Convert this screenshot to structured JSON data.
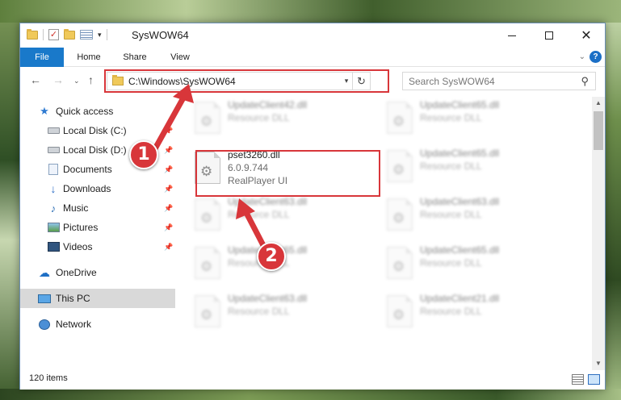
{
  "window": {
    "title": "SysWOW64",
    "controls": {
      "minimize": "–",
      "maximize": "□",
      "close": "✕"
    }
  },
  "ribbon": {
    "tabs": [
      "File",
      "Home",
      "Share",
      "View"
    ],
    "help": "?"
  },
  "navigation": {
    "back": "←",
    "forward": "→",
    "recent": "⌄",
    "up": "↑",
    "address": "C:\\Windows\\SysWOW64",
    "refresh": "↻",
    "search_placeholder": "Search SysWOW64"
  },
  "sidebar": {
    "items": [
      {
        "label": "Quick access",
        "icon": "quick-access-star-icon",
        "pinned": false
      },
      {
        "label": "Local Disk (C:)",
        "icon": "local-disk-icon",
        "pinned": true
      },
      {
        "label": "Local Disk (D:)",
        "icon": "local-disk-icon",
        "pinned": true
      },
      {
        "label": "Documents",
        "icon": "documents-icon",
        "pinned": true
      },
      {
        "label": "Downloads",
        "icon": "downloads-icon",
        "pinned": true
      },
      {
        "label": "Music",
        "icon": "music-icon",
        "pinned": true
      },
      {
        "label": "Pictures",
        "icon": "pictures-icon",
        "pinned": true
      },
      {
        "label": "Videos",
        "icon": "videos-icon",
        "pinned": true
      },
      {
        "label": "OneDrive",
        "icon": "onedrive-icon",
        "pinned": false
      },
      {
        "label": "This PC",
        "icon": "this-pc-icon",
        "pinned": false,
        "selected": true
      },
      {
        "label": "Network",
        "icon": "network-icon",
        "pinned": false
      }
    ]
  },
  "files": {
    "selected": {
      "name": "pset3260.dll",
      "version": "6.0.9.744",
      "description": "RealPlayer UI"
    },
    "left_column": [
      {
        "name": "UpdateClient42.dll",
        "desc": "Resource DLL"
      },
      {
        "name": "UpdateClient63.dll",
        "desc": "Resource DLL"
      },
      {
        "name": "UpdateClient65.dll",
        "desc": "Resource DLL"
      },
      {
        "name": "UpdateClient63.dll",
        "desc": "Resource DLL"
      }
    ],
    "right_column": [
      {
        "name": "UpdateClient65.dll",
        "desc": "Resource DLL"
      },
      {
        "name": "UpdateClient65.dll",
        "desc": "Resource DLL"
      },
      {
        "name": "UpdateClient63.dll",
        "desc": "Resource DLL"
      },
      {
        "name": "UpdateClient65.dll",
        "desc": "Resource DLL"
      },
      {
        "name": "UpdateClient21.dll",
        "desc": "Resource DLL"
      }
    ]
  },
  "status": {
    "item_count": "120 items"
  },
  "annotations": {
    "step1": "1",
    "step2": "2",
    "color": "#d8363a"
  }
}
